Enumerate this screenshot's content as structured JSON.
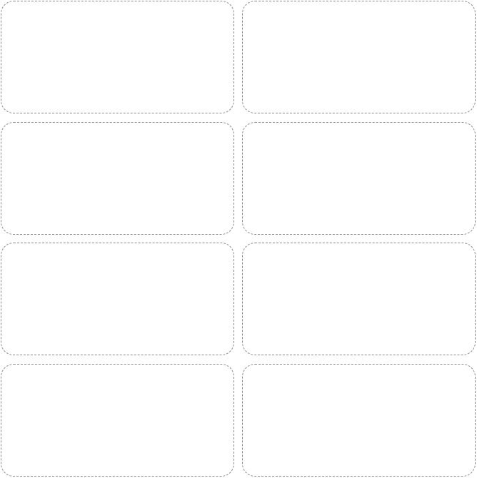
{
  "sheet": {
    "labels": [
      {
        "text": ""
      },
      {
        "text": ""
      },
      {
        "text": ""
      },
      {
        "text": ""
      },
      {
        "text": ""
      },
      {
        "text": ""
      },
      {
        "text": ""
      },
      {
        "text": ""
      }
    ]
  },
  "colors": {
    "background": "#ffffff",
    "outline": "#8a8a8a"
  }
}
